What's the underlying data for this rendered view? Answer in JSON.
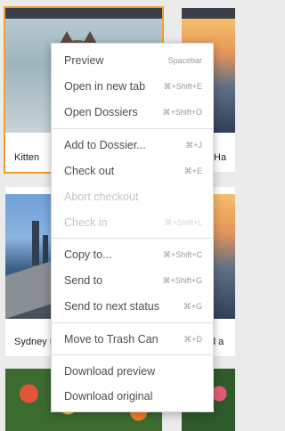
{
  "grid": {
    "cards": [
      {
        "id": "kitten",
        "label": "Kitten",
        "selected": true
      },
      {
        "id": "coast-right-top",
        "label": "Ha"
      },
      {
        "id": "sydney",
        "label": "Sydney B"
      },
      {
        "id": "coast-right-mid",
        "label": "d a"
      },
      {
        "id": "flowers-bottom-left",
        "label": ""
      },
      {
        "id": "flowers-bottom-right",
        "label": ""
      }
    ]
  },
  "context_menu": {
    "items": [
      {
        "label": "Preview",
        "shortcut": "Spacebar",
        "enabled": true
      },
      {
        "label": "Open in new tab",
        "shortcut": "⌘+Shift+E",
        "enabled": true
      },
      {
        "label": "Open Dossiers",
        "shortcut": "⌘+Shift+O",
        "enabled": true
      },
      {
        "label": "Add to Dossier...",
        "shortcut": "⌘+J",
        "enabled": true
      },
      {
        "label": "Check out",
        "shortcut": "⌘+E",
        "enabled": true
      },
      {
        "label": "Abort checkout",
        "shortcut": "",
        "enabled": false
      },
      {
        "label": "Check in",
        "shortcut": "⌘+Shift+L",
        "enabled": false
      },
      {
        "label": "Copy to...",
        "shortcut": "⌘+Shift+C",
        "enabled": true
      },
      {
        "label": "Send to",
        "shortcut": "⌘+Shift+G",
        "enabled": true
      },
      {
        "label": "Send to next status",
        "shortcut": "⌘+G",
        "enabled": true
      },
      {
        "label": "Move to Trash Can",
        "shortcut": "⌘+D",
        "enabled": true
      },
      {
        "label": "Download preview",
        "shortcut": "",
        "enabled": true
      },
      {
        "label": "Download original",
        "shortcut": "",
        "enabled": true
      }
    ]
  },
  "colors": {
    "selection_outline": "#f0a030",
    "card_topbar": "#3a3f4b",
    "menu_text": "#4d4d4d",
    "menu_disabled_text": "#c4c4c4"
  }
}
